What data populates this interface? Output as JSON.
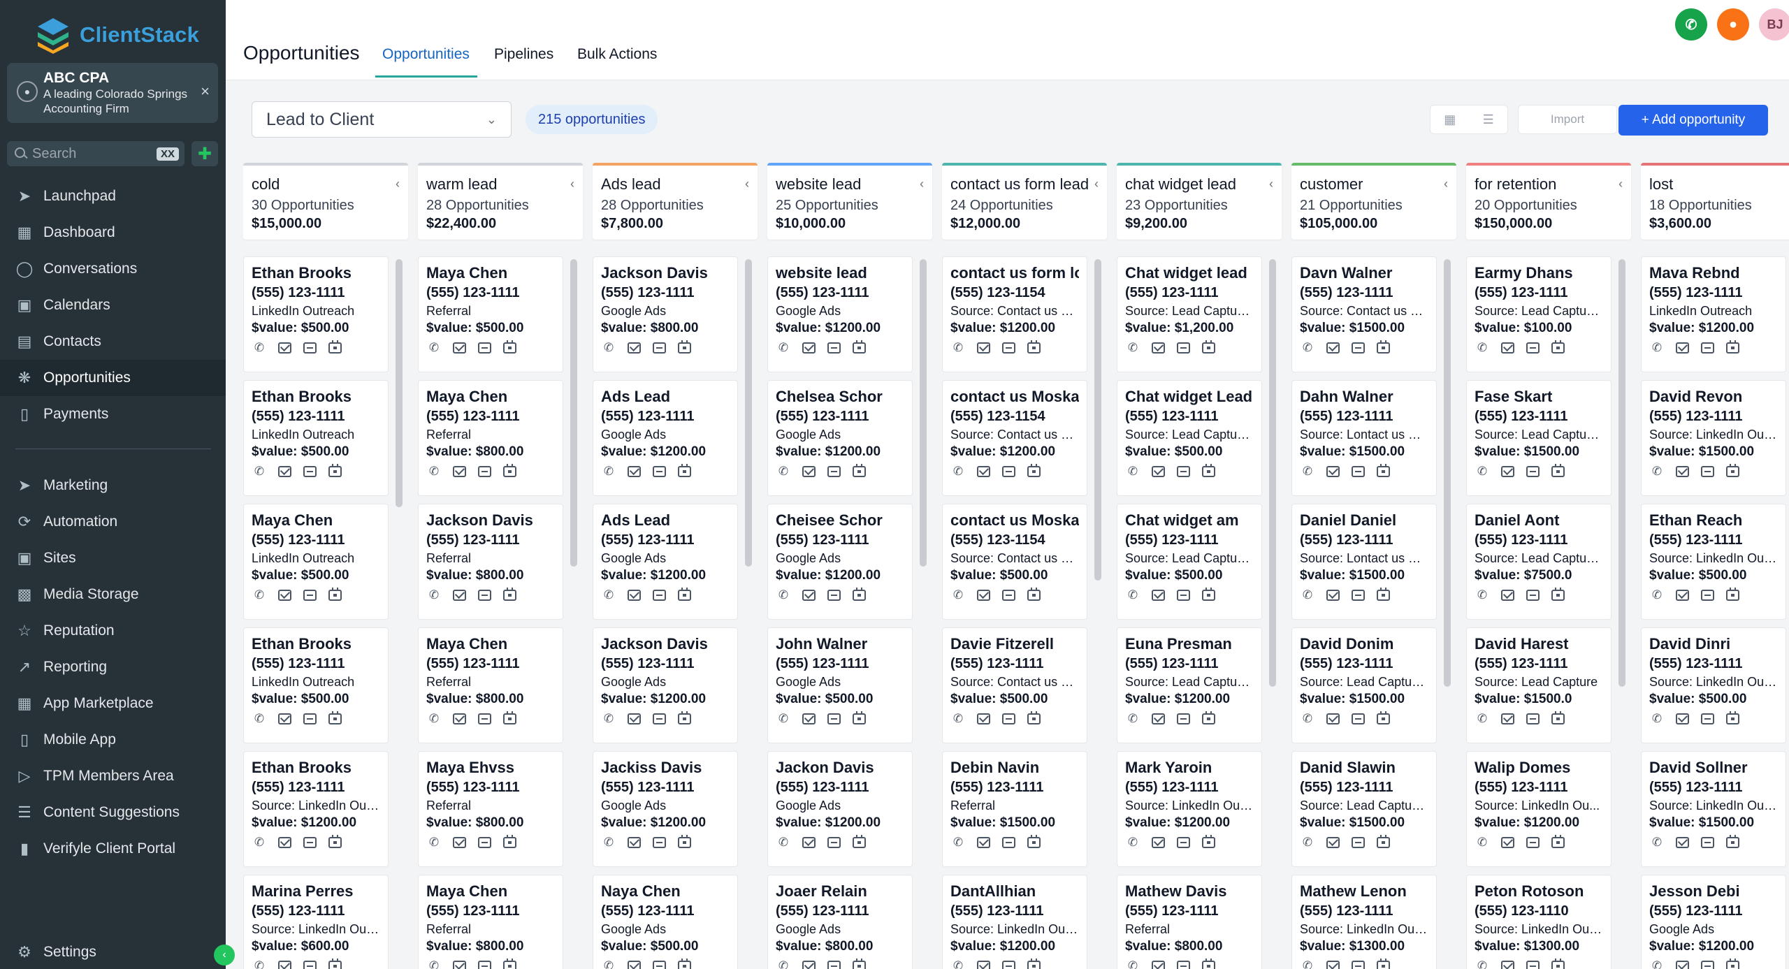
{
  "app": {
    "logo_text": "ClientStack"
  },
  "account": {
    "name": "ABC CPA",
    "subtitle": "A leading Colorado Springs Accounting Firm"
  },
  "sidebar": {
    "search_placeholder": "Search",
    "search_shortcut": "XX",
    "nav_primary": [
      {
        "label": "Launchpad",
        "icon": "rocket-icon",
        "active": false
      },
      {
        "label": "Dashboard",
        "icon": "grid-icon",
        "active": false
      },
      {
        "label": "Conversations",
        "icon": "chat-icon",
        "active": false
      },
      {
        "label": "Calendars",
        "icon": "calendar-icon",
        "active": false
      },
      {
        "label": "Contacts",
        "icon": "contacts-icon",
        "active": false
      },
      {
        "label": "Opportunities",
        "icon": "network-icon",
        "active": true
      },
      {
        "label": "Payments",
        "icon": "receipt-icon",
        "active": false
      }
    ],
    "nav_secondary": [
      {
        "label": "Marketing",
        "icon": "send-icon"
      },
      {
        "label": "Automation",
        "icon": "automation-icon"
      },
      {
        "label": "Sites",
        "icon": "sites-icon"
      },
      {
        "label": "Media Storage",
        "icon": "image-icon"
      },
      {
        "label": "Reputation",
        "icon": "star-icon"
      },
      {
        "label": "Reporting",
        "icon": "trend-icon"
      },
      {
        "label": "App Marketplace",
        "icon": "apps-icon"
      },
      {
        "label": "Mobile App",
        "icon": "phone-icon"
      },
      {
        "label": "TPM Members Area",
        "icon": "members-icon"
      },
      {
        "label": "Content Suggestions",
        "icon": "list-icon"
      },
      {
        "label": "Verifyle Client Portal",
        "icon": "portal-icon"
      }
    ],
    "settings_label": "Settings"
  },
  "header": {
    "title": "Opportunities",
    "tabs": [
      "Opportunities",
      "Pipelines",
      "Bulk Actions"
    ],
    "active_tab": 0,
    "avatar_initials": "BJ"
  },
  "toolbar": {
    "pipeline": "Lead to Client",
    "count_label": "215 opportunities",
    "import_label": "Import",
    "add_label": "+ Add opportunity"
  },
  "colors": {
    "sidebar_bg": "#263238",
    "accent": "#2563eb",
    "call_green": "#16a34a",
    "notify_orange": "#f97316",
    "avatar_pink": "#f4c2d0"
  },
  "columns": [
    {
      "name": "cold",
      "count": "30 Opportunities",
      "value": "$15,000.00",
      "color": "#d1d5db",
      "cards": [
        {
          "name": "Ethan Brooks",
          "phone": "(555) 123-1111",
          "source": "LinkedIn Outreach",
          "value": "$value: $500.00"
        },
        {
          "name": "Ethan Brooks",
          "phone": "(555) 123-1111",
          "source": "LinkedIn Outreach",
          "value": "$value: $500.00"
        },
        {
          "name": "Maya Chen",
          "phone": "(555) 123-1111",
          "source": "LinkedIn Outreach",
          "value": "$value: $500.00"
        },
        {
          "name": "Ethan Brooks",
          "phone": "(555) 123-1111",
          "source": "LinkedIn Outreach",
          "value": "$value: $500.00"
        },
        {
          "name": "Ethan Brooks",
          "phone": "(555) 123-1111",
          "source": "Source: LinkedIn Outr...",
          "value": "$value: $1200.00"
        },
        {
          "name": "Marina Perres",
          "phone": "(555) 123-1111",
          "source": "Source: LinkedIn Outr...",
          "value": "$value: $600.00"
        }
      ]
    },
    {
      "name": "warm lead",
      "count": "28 Opportunities",
      "value": "$22,400.00",
      "color": "#d1d5db",
      "cards": [
        {
          "name": "Maya Chen",
          "phone": "(555) 123-1111",
          "source": "Referral",
          "value": "$value: $500.00"
        },
        {
          "name": "Maya Chen",
          "phone": "(555) 123-1111",
          "source": "Referral",
          "value": "$value: $800.00"
        },
        {
          "name": "Jackson Davis",
          "phone": "(555) 123-1111",
          "source": "Referral",
          "value": "$value: $800.00"
        },
        {
          "name": "Maya Chen",
          "phone": "(555) 123-1111",
          "source": "Referral",
          "value": "$value: $800.00"
        },
        {
          "name": "Maya Ehvss",
          "phone": "(555) 123-1111",
          "source": "Referral",
          "value": "$value: $800.00"
        },
        {
          "name": "Maya Chen",
          "phone": "(555) 123-1111",
          "source": "Referral",
          "value": "$value: $800.00"
        }
      ]
    },
    {
      "name": "Ads lead",
      "count": "28 Opportunities",
      "value": "$7,800.00",
      "color": "#f4a261",
      "cards": [
        {
          "name": "Jackson Davis",
          "phone": "(555) 123-1111",
          "source": "Google Ads",
          "value": "$value: $800.00"
        },
        {
          "name": "Ads Lead",
          "phone": "(555) 123-1111",
          "source": "Google Ads",
          "value": "$value: $1200.00"
        },
        {
          "name": "Ads Lead",
          "phone": "(555) 123-1111",
          "source": "Google Ads",
          "value": "$value: $1200.00"
        },
        {
          "name": "Jackson Davis",
          "phone": "(555) 123-1111",
          "source": "Google Ads",
          "value": "$value: $1200.00"
        },
        {
          "name": "Jackiss Davis",
          "phone": "(555) 123-1111",
          "source": "Google Ads",
          "value": "$value: $1200.00"
        },
        {
          "name": "Naya Chen",
          "phone": "(555) 123-1111",
          "source": "Google Ads",
          "value": "$value: $500.00"
        }
      ]
    },
    {
      "name": "website lead",
      "count": "25 Opportunities",
      "value": "$10,000.00",
      "color": "#60a5fa",
      "cards": [
        {
          "name": "website lead",
          "phone": "(555) 123-1111",
          "source": "Google Ads",
          "value": "$value: $1200.00"
        },
        {
          "name": "Chelsea Schor",
          "phone": "(555) 123-1111",
          "source": "Google Ads",
          "value": "$value: $1200.00"
        },
        {
          "name": "Cheisee Schor",
          "phone": "(555) 123-1111",
          "source": "Google Ads",
          "value": "$value: $1200.00"
        },
        {
          "name": "John Walner",
          "phone": "(555) 123-1111",
          "source": "Google Ads",
          "value": "$value: $500.00"
        },
        {
          "name": "Jackon Davis",
          "phone": "(555) 123-1111",
          "source": "Google Ads",
          "value": "$value: $1200.00"
        },
        {
          "name": "Joaer Relain",
          "phone": "(555) 123-1111",
          "source": "Google Ads",
          "value": "$value: $800.00"
        }
      ]
    },
    {
      "name": "contact us form lead",
      "count": "24 Opportunities",
      "value": "$12,000.00",
      "color": "#4db6ac",
      "cards": [
        {
          "name": "contact us form lo...",
          "phone": "(555) 123-1154",
          "source": "Source: Contact us For...",
          "value": "$value: $1200.00"
        },
        {
          "name": "contact us Moskal",
          "phone": "(555) 123-1154",
          "source": "Source: Contact us For...",
          "value": "$value: $1200.00"
        },
        {
          "name": "contact us Moskal",
          "phone": "(555) 123-1154",
          "source": "Source: Contact us Fo...",
          "value": "$value: $500.00"
        },
        {
          "name": "Davie Fitzerell",
          "phone": "(555) 123-1111",
          "source": "Source: Contact us Fo...",
          "value": "$value: $500.00"
        },
        {
          "name": "Debin Navin",
          "phone": "(555) 123-1111",
          "source": "Referral",
          "value": "$value: $1500.00"
        },
        {
          "name": "DantAllhian",
          "phone": "(555) 123-1111",
          "source": "Source: LinkedIn Outr...",
          "value": "$value: $1200.00"
        }
      ]
    },
    {
      "name": "chat widget lead",
      "count": "23 Opportunities",
      "value": "$9,200.00",
      "color": "#4db6ac",
      "cards": [
        {
          "name": "Chat widget lead",
          "phone": "(555) 123-1111",
          "source": "Source: Lead Capture ...",
          "value": "$value: $1,200.00"
        },
        {
          "name": "Chat widget Lead",
          "phone": "(555) 123-1111",
          "source": "Source: Lead Capture ...",
          "value": "$value: $500.00"
        },
        {
          "name": "Chat widget am",
          "phone": "(555) 123-1111",
          "source": "Source: Lead Capture ...",
          "value": "$value: $500.00"
        },
        {
          "name": "Euna Presman",
          "phone": "(555) 123-1111",
          "source": "Source: Lead Capture ...",
          "value": "$value: $1200.00"
        },
        {
          "name": "Mark Yaroin",
          "phone": "(555) 123-1111",
          "source": "Source: LinkedIn Outr...",
          "value": "$value: $1200.00"
        },
        {
          "name": "Mathew Davis",
          "phone": "(555) 123-1111",
          "source": "Referral",
          "value": "$value: $800.00"
        }
      ]
    },
    {
      "name": "customer",
      "count": "21 Opportunities",
      "value": "$105,000.00",
      "color": "#66bb6a",
      "cards": [
        {
          "name": "Davn Walner",
          "phone": "(555) 123-1111",
          "source": "Source: Contact us For...",
          "value": "$value: $1500.00"
        },
        {
          "name": "Dahn Walner",
          "phone": "(555) 123-1111",
          "source": "Source: Lontact us For...",
          "value": "$value: $1500.00"
        },
        {
          "name": "Daniel Daniel",
          "phone": "(555) 123-1111",
          "source": "Source: Lontact us For...",
          "value": "$value: $1500.00"
        },
        {
          "name": "David Donim",
          "phone": "(555) 123-1111",
          "source": "Source: Lead Capture ...",
          "value": "$value: $1500.00"
        },
        {
          "name": "Danid Slawin",
          "phone": "(555) 123-1111",
          "source": "Source: Lead Capture ...",
          "value": "$value: $1500.00"
        },
        {
          "name": "Mathew Lenon",
          "phone": "(555) 123-1111",
          "source": "Source: LinkedIn Outr...",
          "value": "$value: $1300.00"
        }
      ]
    },
    {
      "name": "for retention",
      "count": "20 Opportunities",
      "value": "$150,000.00",
      "color": "#f08080",
      "cards": [
        {
          "name": "Earmy Dhans",
          "phone": "(555) 123-1111",
          "source": "Source: Lead Capture ...",
          "value": "$value: $100.00"
        },
        {
          "name": "Fase Skart",
          "phone": "(555) 123-1111",
          "source": "Source: Lead Capture ...",
          "value": "$value: $1500.00"
        },
        {
          "name": "Daniel Aont",
          "phone": "(555) 123-1111",
          "source": "Source: Lead Capture ...",
          "value": "$value: $7500.0"
        },
        {
          "name": "David Harest",
          "phone": "(555) 123-1111",
          "source": "Source: Lead Capture",
          "value": "$value: $1500.0"
        },
        {
          "name": "Walip Domes",
          "phone": "(555) 123-1111",
          "source": "Source: LinkedIn Ou...",
          "value": "$value: $1200.00"
        },
        {
          "name": "Peton Rotoson",
          "phone": "(555) 123-1110",
          "source": "Source: LinkedIn Outr...",
          "value": "$value: $1300.00"
        }
      ]
    },
    {
      "name": "lost",
      "count": "18 Opportunities",
      "value": "$3,600.00",
      "color": "#e57373",
      "cards": [
        {
          "name": "Mava Rebnd",
          "phone": "(555) 123-1111",
          "source": "LinkedIn Outreach",
          "value": "$value: $1200.00"
        },
        {
          "name": "David Revon",
          "phone": "(555) 123-1111",
          "source": "Source: LinkedIn Outr...",
          "value": "$value: $1500.00"
        },
        {
          "name": "Ethan Reach",
          "phone": "(555) 123-1111",
          "source": "Source: LinkedIn Outr...",
          "value": "$value: $500.00"
        },
        {
          "name": "David Dinri",
          "phone": "(555) 123-1111",
          "source": "Source: LinkedIn Outr...",
          "value": "$value: $500.00"
        },
        {
          "name": "David Sollner",
          "phone": "(555) 123-1111",
          "source": "Source: LinkedIn Outr...",
          "value": "$value: $1500.00"
        },
        {
          "name": "Jesson Debi",
          "phone": "(555) 123-1111",
          "source": "Google Ads",
          "value": "$value: $1200.00"
        }
      ]
    }
  ]
}
